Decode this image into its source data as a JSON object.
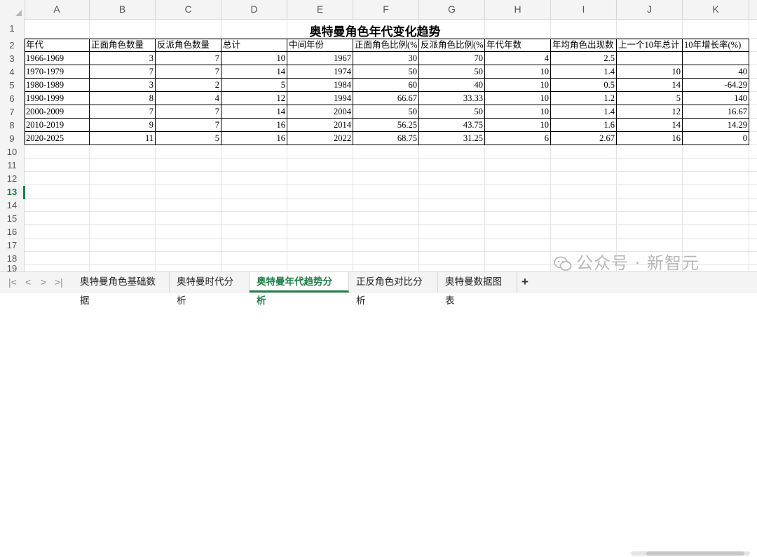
{
  "columns": [
    "A",
    "B",
    "C",
    "D",
    "E",
    "F",
    "G",
    "H",
    "I",
    "J",
    "K"
  ],
  "rows": [
    "1",
    "2",
    "3",
    "4",
    "5",
    "6",
    "7",
    "8",
    "9",
    "10",
    "11",
    "12",
    "13",
    "14",
    "15",
    "16",
    "17",
    "18",
    "19"
  ],
  "selected_row": "13",
  "title": "奥特曼角色年代变化趋势",
  "headers": [
    "年代",
    "正面角色数量",
    "反派角色数量",
    "总计",
    "中间年份",
    "正面角色比例(%",
    "反派角色比例(%",
    "年代年数",
    "年均角色出现数",
    "上一个10年总计",
    "10年增长率(%)"
  ],
  "table": [
    [
      "1966-1969",
      "3",
      "7",
      "10",
      "1967",
      "30",
      "70",
      "4",
      "2.5",
      "",
      ""
    ],
    [
      "1970-1979",
      "7",
      "7",
      "14",
      "1974",
      "50",
      "50",
      "10",
      "1.4",
      "10",
      "40"
    ],
    [
      "1980-1989",
      "3",
      "2",
      "5",
      "1984",
      "60",
      "40",
      "10",
      "0.5",
      "14",
      "-64.29"
    ],
    [
      "1990-1999",
      "8",
      "4",
      "12",
      "1994",
      "66.67",
      "33.33",
      "10",
      "1.2",
      "5",
      "140"
    ],
    [
      "2000-2009",
      "7",
      "7",
      "14",
      "2004",
      "50",
      "50",
      "10",
      "1.4",
      "12",
      "16.67"
    ],
    [
      "2010-2019",
      "9",
      "7",
      "16",
      "2014",
      "56.25",
      "43.75",
      "10",
      "1.6",
      "14",
      "14.29"
    ],
    [
      "2020-2025",
      "11",
      "5",
      "16",
      "2022",
      "68.75",
      "31.25",
      "6",
      "2.67",
      "16",
      "0"
    ]
  ],
  "tabs": [
    "奥特曼角色基础数据",
    "奥特曼时代分析",
    "奥特曼年代趋势分析",
    "正反角色对比分析",
    "奥特曼数据图表"
  ],
  "active_tab": "奥特曼年代趋势分析",
  "add_tab": "+",
  "nav": [
    "|<",
    "<",
    ">",
    ">|"
  ],
  "watermark": "公众号 · 新智元",
  "accent": "#1e7e45"
}
